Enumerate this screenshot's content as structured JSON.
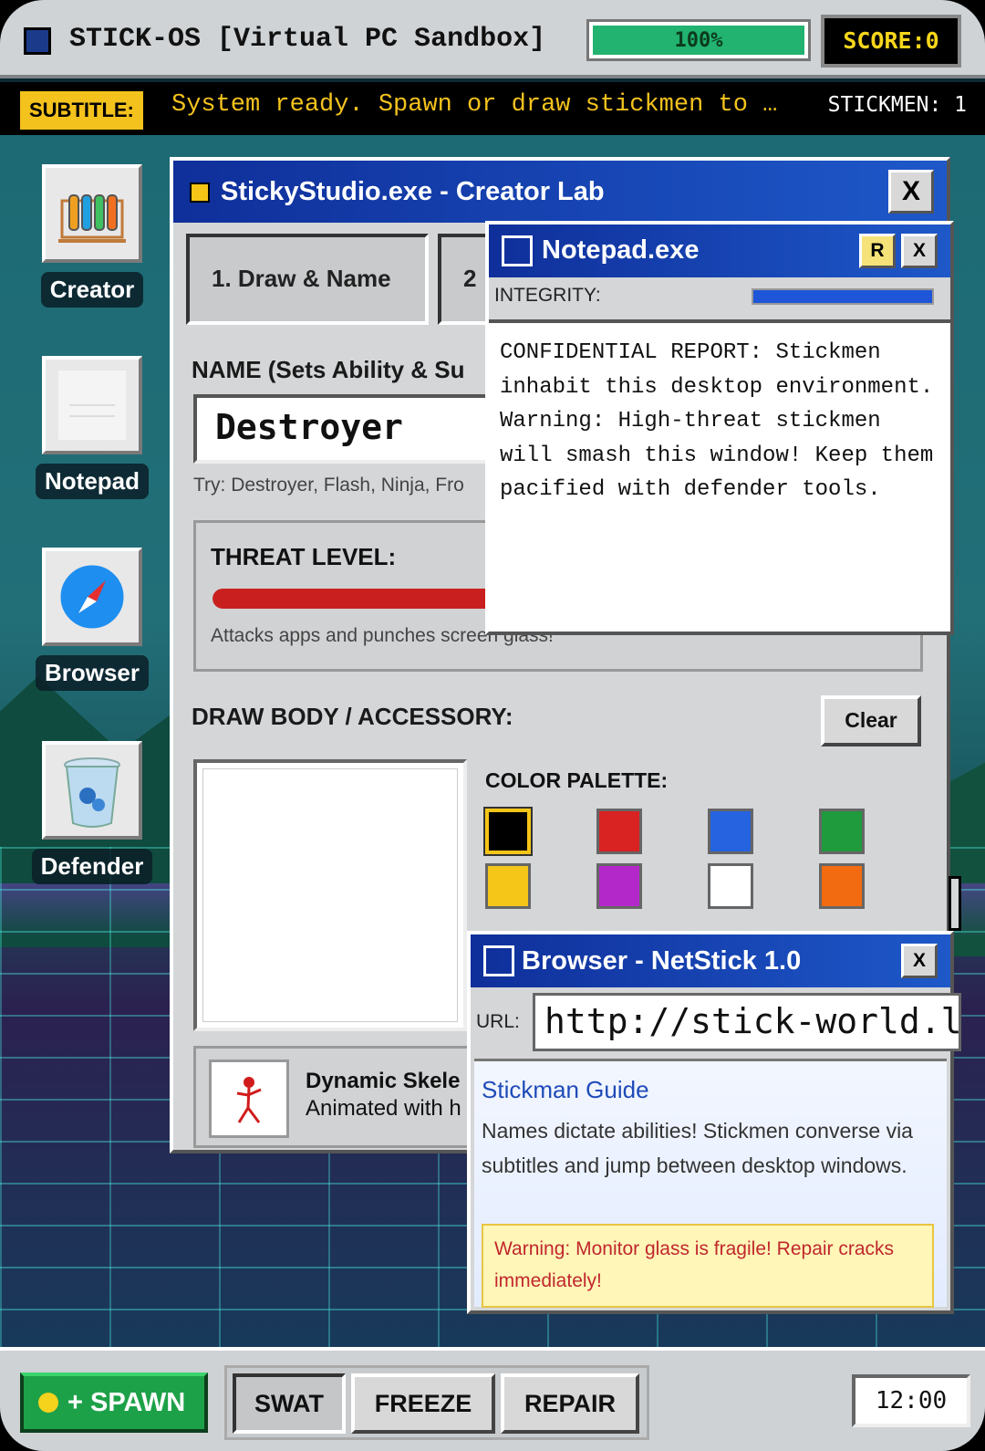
{
  "topbar": {
    "title": "STICK-OS [Virtual PC Sandbox]",
    "progress_text": "100%",
    "progress_value": 100,
    "score": "SCORE:0"
  },
  "subtitle": {
    "badge": "SUBTITLE:",
    "text": "System ready. Spawn or draw stickmen to …",
    "count": "STICKMEN: 1"
  },
  "desktop_icons": [
    {
      "label": "Creator",
      "icon": "test-tubes-icon"
    },
    {
      "label": "Notepad",
      "icon": "notepad-icon"
    },
    {
      "label": "Browser",
      "icon": "compass-icon"
    },
    {
      "label": "Defender",
      "icon": "trash-icon"
    }
  ],
  "studio": {
    "title": "StickyStudio.exe - Creator Lab",
    "close": "X",
    "tabs": [
      "1. Draw & Name",
      "2"
    ],
    "name_label": "NAME (Sets Ability & Su",
    "name_value": "Destroyer",
    "hint": "Try: Destroyer, Flash, Ninja, Fro",
    "threat_label": "THREAT LEVEL:",
    "threat_value": 0.95,
    "threat_desc": "Attacks apps and punches screen glass!",
    "draw_label": "DRAW BODY / ACCESSORY:",
    "clear": "Clear",
    "palette_label": "COLOR PALETTE:",
    "palette": [
      "#000000",
      "#d92222",
      "#2563e0",
      "#1f9a3c",
      "#f5c518",
      "#b328c9",
      "#ffffff",
      "#f26b11"
    ],
    "selected_color": "#000000",
    "skeleton_title": "Dynamic Skele",
    "skeleton_desc": "Animated with h"
  },
  "notepad": {
    "title": "Notepad.exe",
    "r_button": "R",
    "close": "X",
    "integrity_label": "INTEGRITY:",
    "integrity_value": 1.0,
    "body": "CONFIDENTIAL REPORT: Stickmen inhabit this desktop environment. Warning: High-threat stickmen will smash this window! Keep them pacified with defender tools."
  },
  "browser": {
    "title": "Browser - NetStick 1.0",
    "close": "X",
    "url_label": "URL:",
    "url": "http://stick-world.l",
    "link": "Stickman Guide",
    "text": "Names dictate abilities! Stickmen converse via subtitles and jump between desktop windows.",
    "warning": "Warning: Monitor glass is fragile! Repair cracks immediately!"
  },
  "taskbar": {
    "spawn": "+ SPAWN",
    "tools": [
      "SWAT",
      "FREEZE",
      "REPAIR"
    ],
    "active_tool": "SWAT",
    "clock": "12:00"
  }
}
